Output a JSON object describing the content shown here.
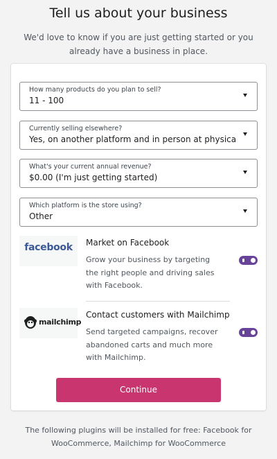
{
  "header": {
    "title": "Tell us about your business",
    "subtitle": "We'd love to know if you are just getting started or you already have a business in place."
  },
  "form": {
    "products": {
      "label": "How many products do you plan to sell?",
      "value": "11 - 100"
    },
    "selling_elsewhere": {
      "label": "Currently selling elsewhere?",
      "value": "Yes, on another platform and in person at physical stores"
    },
    "revenue": {
      "label": "What's your current annual revenue?",
      "value": "$0.00 (I'm just getting started)"
    },
    "platform": {
      "label": "Which platform is the store using?",
      "value": "Other"
    }
  },
  "extensions": {
    "facebook": {
      "logo_text": "facebook",
      "title": "Market on Facebook",
      "description": "Grow your business by targeting the right people and driving sales with Facebook.",
      "enabled": true
    },
    "mailchimp": {
      "logo_text": "mailchimp",
      "title": "Contact customers with Mailchimp",
      "description": "Send targeted campaigns, recover abandoned carts and much more with Mailchimp.",
      "enabled": true
    }
  },
  "actions": {
    "continue_label": "Continue"
  },
  "footer": {
    "note": "The following plugins will be installed for free: Facebook for WooCommerce, Mailchimp for WooCommerce"
  },
  "colors": {
    "primary_button": "#c9356e",
    "toggle_on": "#674399",
    "facebook_brand": "#3b5998"
  }
}
